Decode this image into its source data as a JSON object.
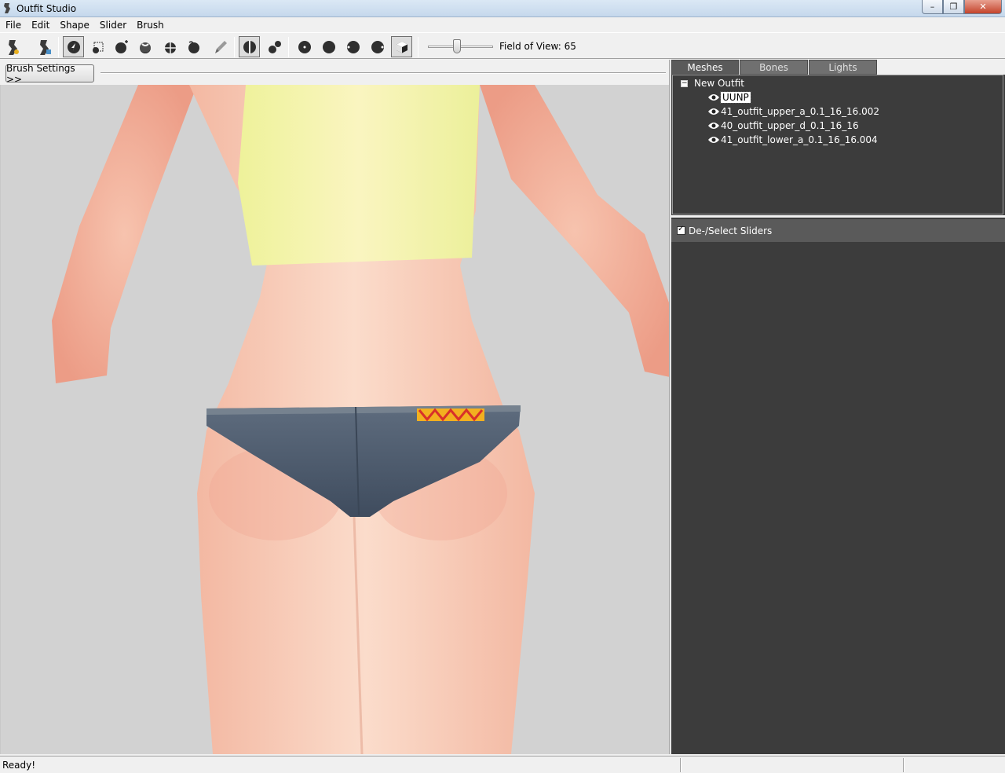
{
  "window": {
    "title": "Outfit Studio",
    "minimize_glyph": "–",
    "restore_glyph": "❐",
    "close_glyph": "✕"
  },
  "menu": [
    "File",
    "Edit",
    "Shape",
    "Slider",
    "Brush"
  ],
  "toolbar": {
    "field_of_view_label": "Field of View: 65",
    "field_of_view_slider_level": 0.45,
    "tools": [
      "new-outfit-icon",
      "load-outfit-icon",
      "select-brush-icon",
      "mask-brush-icon",
      "inflate-brush-icon",
      "deflate-brush-icon",
      "move-brush-icon",
      "smooth-brush-icon",
      "weight-brush-icon",
      "mirror-x-icon",
      "connected-only-icon",
      "view-dots-icon",
      "view-solid-icon",
      "view-half-icon",
      "view-shaded-icon",
      "view-textured-cube-icon"
    ]
  },
  "brush_settings": {
    "label": "Brush Settings >>"
  },
  "right_panel": {
    "tabs": [
      "Meshes",
      "Bones",
      "Lights"
    ],
    "active_tab": "Meshes",
    "tree": {
      "root": "New Outfit",
      "root_toggle": "−",
      "items": [
        {
          "label": "UUNP",
          "selected": true,
          "icon": "eye-icon"
        },
        {
          "label": "41_outfit_upper_a_0.1_16_16.002",
          "selected": false,
          "icon": "eye-icon"
        },
        {
          "label": "40_outfit_upper_d_0.1_16_16",
          "selected": false,
          "icon": "eye-icon"
        },
        {
          "label": "41_outfit_lower_a_0.1_16_16.004",
          "selected": false,
          "icon": "eye-icon"
        }
      ]
    },
    "sliders_header": {
      "label": "De-/Select Sliders",
      "checked": true
    }
  },
  "status": {
    "text": "Ready!"
  },
  "colors": {
    "viewport_bg": "#d2d2d2",
    "panel_dark": "#3c3c3c",
    "skin": "#f2b49a",
    "top_yellow": "#f3ee9c",
    "shorts_denim": "#4d5b6d"
  }
}
